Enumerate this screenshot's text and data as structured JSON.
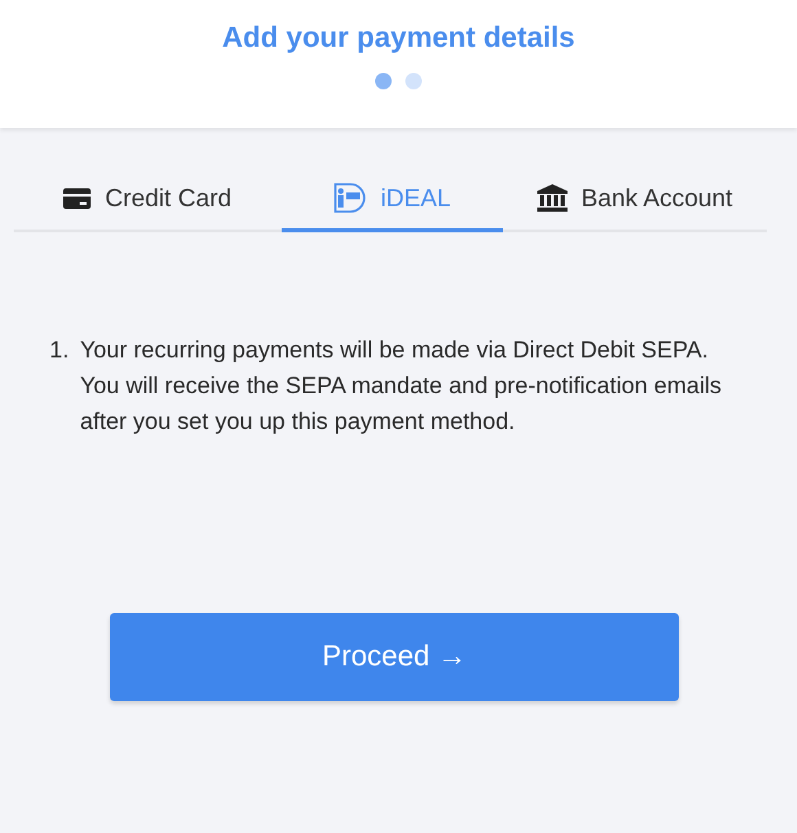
{
  "header": {
    "title": "Add your payment details",
    "steps": [
      {
        "selected": true
      },
      {
        "selected": false
      }
    ]
  },
  "tabs": [
    {
      "kind": "card",
      "label": "Credit Card",
      "selected": false
    },
    {
      "kind": "ideal",
      "label": "iDEAL",
      "selected": true
    },
    {
      "kind": "bank",
      "label": "Bank Account",
      "selected": false
    }
  ],
  "notes": [
    {
      "number": "1.",
      "text": "Your recurring payments will be made via Direct Debit SEPA. You will receive the SEPA mandate and pre-notification emails after you set you up this payment method."
    }
  ],
  "button": {
    "label": "Proceed →"
  }
}
